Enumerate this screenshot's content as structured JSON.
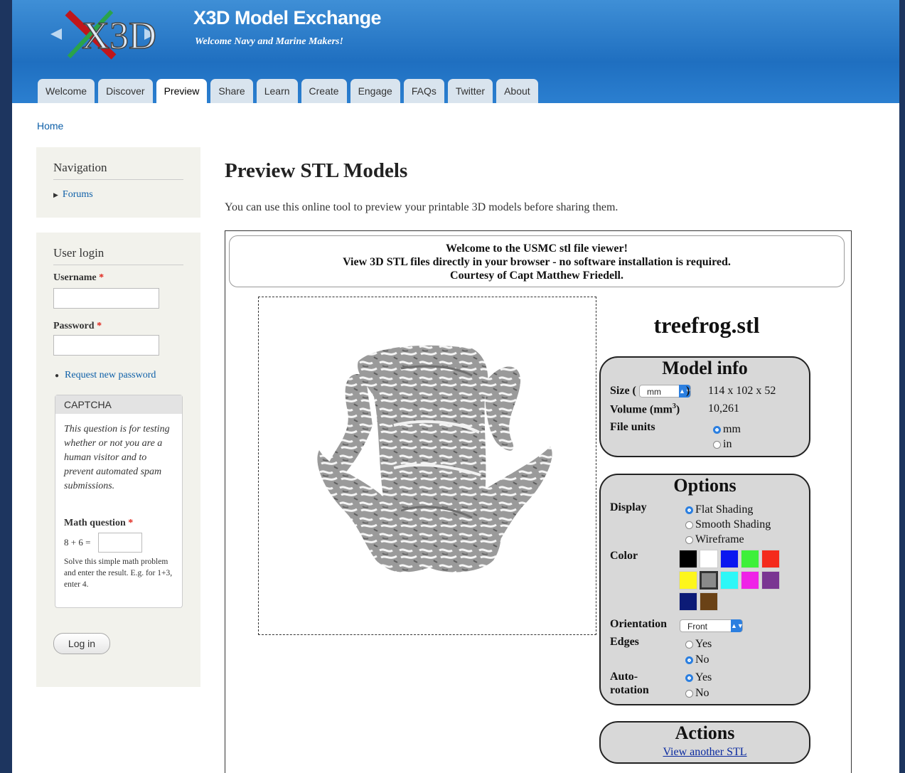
{
  "header": {
    "site_name": "X3D Model Exchange",
    "slogan": "Welcome Navy and Marine Makers!",
    "logo_text": "X3D"
  },
  "tabs": [
    {
      "label": "Welcome"
    },
    {
      "label": "Discover"
    },
    {
      "label": "Preview",
      "active": true
    },
    {
      "label": "Share"
    },
    {
      "label": "Learn"
    },
    {
      "label": "Create"
    },
    {
      "label": "Engage"
    },
    {
      "label": "FAQs"
    },
    {
      "label": "Twitter"
    },
    {
      "label": "About"
    }
  ],
  "breadcrumb": "Home",
  "sidebar": {
    "navigation": {
      "title": "Navigation",
      "items": [
        "Forums"
      ]
    },
    "login": {
      "title": "User login",
      "username_label": "Username",
      "password_label": "Password",
      "required_mark": "*",
      "request_password": "Request new password",
      "captcha": {
        "title": "CAPTCHA",
        "description": "This question is for testing whether or not you are a human visitor and to prevent automated spam submissions.",
        "math_label": "Math question",
        "math_prompt": "8 + 6 =",
        "help": "Solve this simple math problem and enter the result. E.g. for 1+3, enter 4."
      },
      "login_button": "Log in"
    }
  },
  "main": {
    "title": "Preview STL Models",
    "intro": "You can use this online tool to preview your printable 3D models before sharing them."
  },
  "viewer": {
    "welcome_lines": [
      "Welcome to the USMC stl file viewer!",
      "View 3D STL files directly in your browser - no software installation is required.",
      "Courtesy of Capt Matthew Friedell."
    ],
    "filename": "treefrog.stl",
    "model_info": {
      "title": "Model info",
      "size_label": "Size (",
      "size_label_close": ")",
      "size_unit": "mm",
      "size_value": "114 x 102 x 52",
      "volume_label": "Volume (mm",
      "volume_sup": "3",
      "volume_label_close": ")",
      "volume_value": "10,261",
      "file_units_label": "File units",
      "units": [
        {
          "label": "mm",
          "selected": true
        },
        {
          "label": "in",
          "selected": false
        }
      ]
    },
    "options": {
      "title": "Options",
      "display_label": "Display",
      "display_options": [
        {
          "label": "Flat Shading",
          "selected": true
        },
        {
          "label": "Smooth Shading",
          "selected": false
        },
        {
          "label": "Wireframe",
          "selected": false
        }
      ],
      "color_label": "Color",
      "colors": [
        "#000000",
        "#ffffff",
        "#0a17f0",
        "#3ef03a",
        "#f42a1c",
        "#fdf61c",
        "#8a8a8a",
        "#2df7f7",
        "#ef22e7",
        "#7a3592",
        "#0c1b77",
        "#6a4216"
      ],
      "selected_color_index": 6,
      "orientation_label": "Orientation",
      "orientation_value": "Front",
      "edges_label": "Edges",
      "edges_options": [
        {
          "label": "Yes",
          "selected": false
        },
        {
          "label": "No",
          "selected": true
        }
      ],
      "autorotation_label_1": "Auto-",
      "autorotation_label_2": "rotation",
      "autorotation_options": [
        {
          "label": "Yes",
          "selected": true
        },
        {
          "label": "No",
          "selected": false
        }
      ]
    },
    "actions": {
      "title": "Actions",
      "link": "View another STL"
    }
  }
}
